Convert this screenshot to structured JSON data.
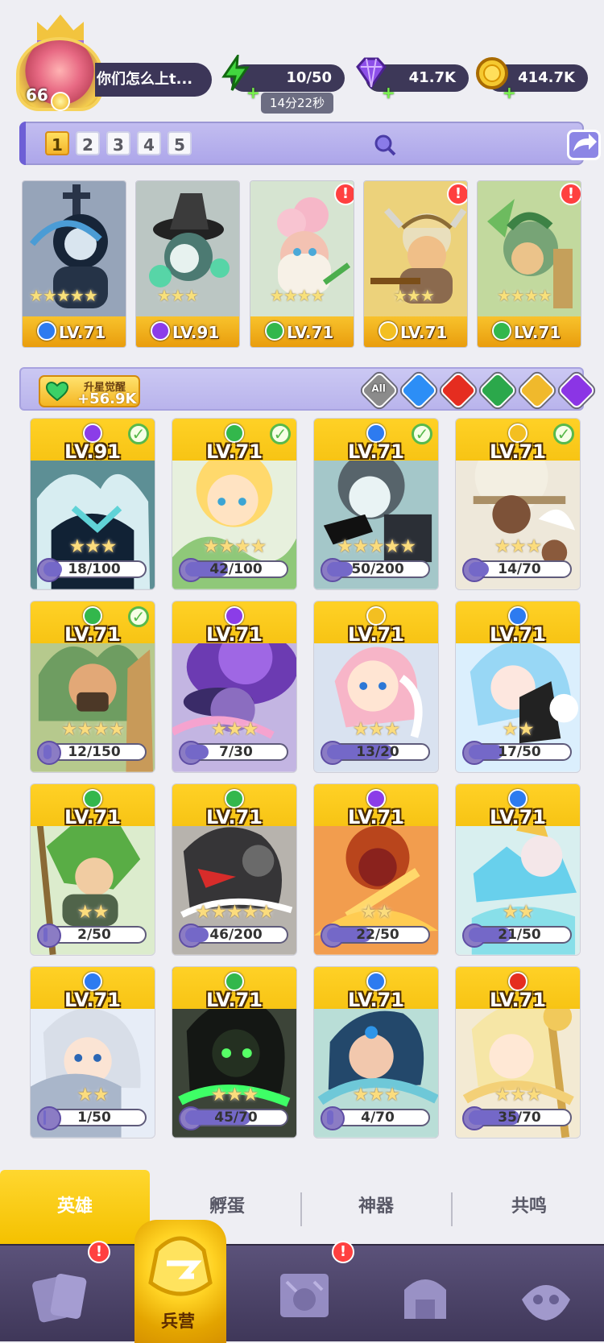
{
  "profile": {
    "level": "66",
    "name": "你们怎么上t..."
  },
  "resources": {
    "energy": "10/50",
    "energy_timer": "14分22秒",
    "gems": "41.7K",
    "gold": "414.7K"
  },
  "teams": {
    "tabs": [
      "1",
      "2",
      "3",
      "4",
      "5"
    ],
    "active": "1",
    "members": [
      {
        "level": "LV.71",
        "stars": "★★★★★",
        "element": "water",
        "color": "#2d7bf0",
        "alert": false
      },
      {
        "level": "LV.91",
        "stars": "★★★",
        "element": "dark",
        "color": "#8b3de8",
        "alert": false
      },
      {
        "level": "LV.71",
        "stars": "★★★★",
        "element": "nature",
        "color": "#33b74c",
        "alert": true
      },
      {
        "level": "LV.71",
        "stars": "★★★",
        "element": "light",
        "color": "#f3bf21",
        "alert": true
      },
      {
        "level": "LV.71",
        "stars": "★★★★",
        "element": "nature",
        "color": "#33b74c",
        "alert": true
      }
    ]
  },
  "filter": {
    "awaken_title": "升星觉醒",
    "awaken_value": "+56.9K",
    "elements": [
      {
        "name": "All",
        "color": "#888888"
      },
      {
        "name": "water",
        "color": "#2c8ef6"
      },
      {
        "name": "fire",
        "color": "#e52d20"
      },
      {
        "name": "nature",
        "color": "#2ba84b"
      },
      {
        "name": "light",
        "color": "#f0b92c"
      },
      {
        "name": "dark",
        "color": "#8b35e5"
      }
    ]
  },
  "heroes": [
    {
      "level": "LV.91",
      "stars": "★★★",
      "progress": "18/100",
      "element_color": "#8b3de8",
      "check": true,
      "fill": 0.18
    },
    {
      "level": "LV.71",
      "stars": "★★★★",
      "progress": "42/100",
      "element_color": "#33b74c",
      "check": true,
      "fill": 0.42
    },
    {
      "level": "LV.71",
      "stars": "★★★★★",
      "progress": "50/200",
      "element_color": "#2d7bf0",
      "check": true,
      "fill": 0.25
    },
    {
      "level": "LV.71",
      "stars": "★★★",
      "progress": "14/70",
      "element_color": "#f3bf21",
      "check": true,
      "fill": 0.2
    },
    {
      "level": "LV.71",
      "stars": "★★★★",
      "progress": "12/150",
      "element_color": "#33b74c",
      "check": true,
      "fill": 0.08
    },
    {
      "level": "LV.71",
      "stars": "★★★",
      "progress": "7/30",
      "element_color": "#8b3de8",
      "check": false,
      "fill": 0.23
    },
    {
      "level": "LV.71",
      "stars": "★★★",
      "progress": "13/20",
      "element_color": "#f3bf21",
      "check": false,
      "fill": 0.65
    },
    {
      "level": "LV.71",
      "stars": "★★",
      "progress": "17/50",
      "element_color": "#2d7bf0",
      "check": false,
      "fill": 0.34
    },
    {
      "level": "LV.71",
      "stars": "★★",
      "progress": "2/50",
      "element_color": "#33b74c",
      "check": false,
      "fill": 0.04
    },
    {
      "level": "LV.71",
      "stars": "★★★★★",
      "progress": "46/200",
      "element_color": "#33b74c",
      "check": false,
      "fill": 0.23
    },
    {
      "level": "LV.71",
      "stars": "★★",
      "progress": "22/50",
      "element_color": "#8b3de8",
      "check": false,
      "fill": 0.44
    },
    {
      "level": "LV.71",
      "stars": "★★",
      "progress": "21/50",
      "element_color": "#2d7bf0",
      "check": false,
      "fill": 0.42
    },
    {
      "level": "LV.71",
      "stars": "★★",
      "progress": "1/50",
      "element_color": "#2d7bf0",
      "check": false,
      "fill": 0.02
    },
    {
      "level": "LV.71",
      "stars": "★★★",
      "progress": "45/70",
      "element_color": "#33b74c",
      "check": false,
      "fill": 0.64
    },
    {
      "level": "LV.71",
      "stars": "★★★",
      "progress": "4/70",
      "element_color": "#2d7bf0",
      "check": false,
      "fill": 0.06
    },
    {
      "level": "LV.71",
      "stars": "★★★",
      "progress": "35/70",
      "element_color": "#e52d20",
      "check": false,
      "fill": 0.5
    }
  ],
  "subtabs": [
    "英雄",
    "孵蛋",
    "神器",
    "共鸣"
  ],
  "bottom_nav": {
    "active_label": "兵营",
    "items": [
      "cards",
      "barracks",
      "map",
      "temple",
      "spirit"
    ]
  }
}
